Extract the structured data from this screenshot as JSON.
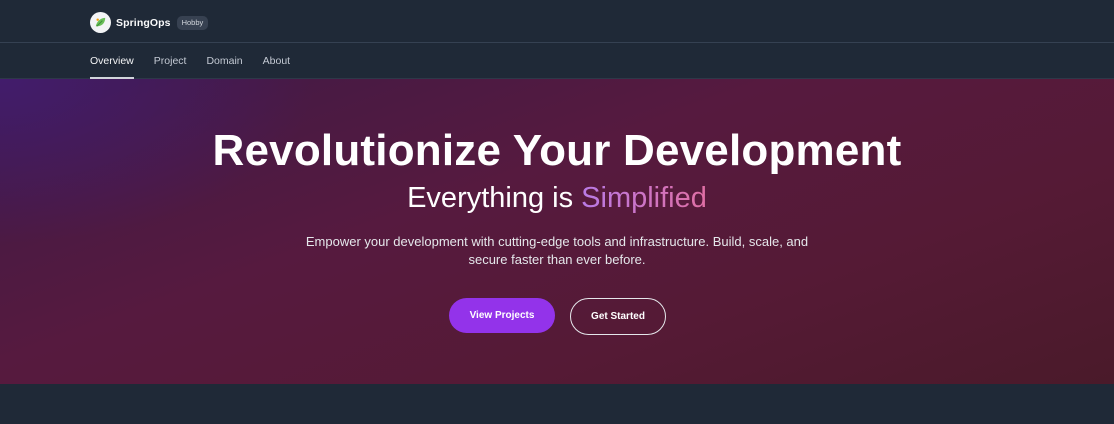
{
  "header": {
    "brand_name": "SpringOps",
    "plan_badge": "Hobby",
    "logo_icon": "spring-leaf-icon"
  },
  "nav": {
    "tabs": [
      {
        "label": "Overview",
        "active": true
      },
      {
        "label": "Project",
        "active": false
      },
      {
        "label": "Domain",
        "active": false
      },
      {
        "label": "About",
        "active": false
      }
    ]
  },
  "hero": {
    "title": "Revolutionize Your Development",
    "subtitle_prefix": "Everything is",
    "subtitle_accent": "Simplified",
    "description": "Empower your development with cutting-edge tools and infrastructure. Build, scale, and secure faster than ever before.",
    "primary_button": "View Projects",
    "secondary_button": "Get Started"
  },
  "colors": {
    "background": "#1f2937",
    "primary": "#9333ea",
    "accent_gradient_start": "#b97ae6",
    "accent_gradient_end": "#e06fa4"
  }
}
